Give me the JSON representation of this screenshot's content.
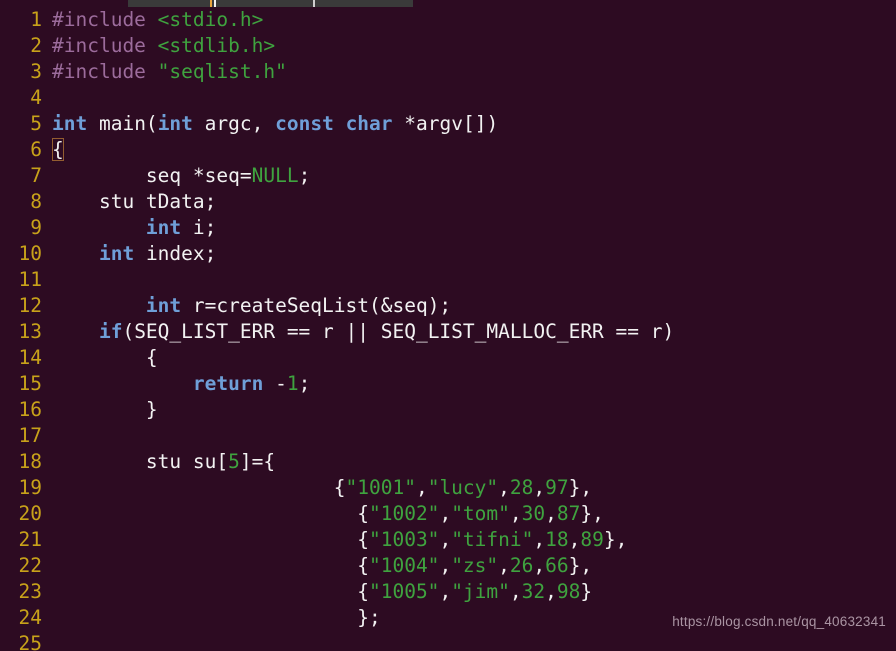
{
  "window": {
    "titlebar_visible_strip": true
  },
  "editor": {
    "background_color": "#2d0b22",
    "line_number_color": "#c8a21a",
    "default_text_color": "#f2f2f2",
    "keyword_color": "#6f9fd8",
    "string_color": "#3fa33f",
    "preprocessor_color": "#9c6c9c",
    "first_line_number": 1,
    "last_line_number": 25,
    "lines": [
      {
        "n": "1",
        "tokens": [
          {
            "t": "#include ",
            "c": "pp"
          },
          {
            "t": "<stdio.h>",
            "c": "str"
          }
        ]
      },
      {
        "n": "2",
        "tokens": [
          {
            "t": "#include ",
            "c": "pp"
          },
          {
            "t": "<stdlib.h>",
            "c": "str"
          }
        ]
      },
      {
        "n": "3",
        "tokens": [
          {
            "t": "#include ",
            "c": "pp"
          },
          {
            "t": "\"seqlist.h\"",
            "c": "str"
          }
        ]
      },
      {
        "n": "4",
        "tokens": []
      },
      {
        "n": "5",
        "tokens": [
          {
            "t": "int",
            "c": "k"
          },
          {
            "t": " main(",
            "c": "pl"
          },
          {
            "t": "int",
            "c": "k"
          },
          {
            "t": " argc, ",
            "c": "pl"
          },
          {
            "t": "const",
            "c": "k"
          },
          {
            "t": " ",
            "c": "pl"
          },
          {
            "t": "char",
            "c": "k"
          },
          {
            "t": " *argv[])",
            "c": "pl"
          }
        ]
      },
      {
        "n": "6",
        "tokens": [
          {
            "t": "{",
            "c": "cursor"
          }
        ]
      },
      {
        "n": "7",
        "tokens": [
          {
            "t": "        seq *seq=",
            "c": "pl"
          },
          {
            "t": "NULL",
            "c": "cst"
          },
          {
            "t": ";",
            "c": "pl"
          }
        ]
      },
      {
        "n": "8",
        "tokens": [
          {
            "t": "    stu tData;",
            "c": "pl"
          }
        ]
      },
      {
        "n": "9",
        "tokens": [
          {
            "t": "        ",
            "c": "pl"
          },
          {
            "t": "int",
            "c": "k"
          },
          {
            "t": " i;",
            "c": "pl"
          }
        ]
      },
      {
        "n": "10",
        "tokens": [
          {
            "t": "    ",
            "c": "pl"
          },
          {
            "t": "int",
            "c": "k"
          },
          {
            "t": " index;",
            "c": "pl"
          }
        ]
      },
      {
        "n": "11",
        "tokens": []
      },
      {
        "n": "12",
        "tokens": [
          {
            "t": "        ",
            "c": "pl"
          },
          {
            "t": "int",
            "c": "k"
          },
          {
            "t": " r=createSeqList(&seq);",
            "c": "pl"
          }
        ]
      },
      {
        "n": "13",
        "tokens": [
          {
            "t": "    ",
            "c": "pl"
          },
          {
            "t": "if",
            "c": "k"
          },
          {
            "t": "(SEQ_LIST_ERR == r || SEQ_LIST_MALLOC_ERR == r)",
            "c": "pl"
          }
        ]
      },
      {
        "n": "14",
        "tokens": [
          {
            "t": "        {",
            "c": "pl"
          }
        ]
      },
      {
        "n": "15",
        "tokens": [
          {
            "t": "            ",
            "c": "pl"
          },
          {
            "t": "return",
            "c": "k"
          },
          {
            "t": " -",
            "c": "pl"
          },
          {
            "t": "1",
            "c": "num"
          },
          {
            "t": ";",
            "c": "pl"
          }
        ]
      },
      {
        "n": "16",
        "tokens": [
          {
            "t": "        }",
            "c": "pl"
          }
        ]
      },
      {
        "n": "17",
        "tokens": []
      },
      {
        "n": "18",
        "tokens": [
          {
            "t": "        stu su[",
            "c": "pl"
          },
          {
            "t": "5",
            "c": "num"
          },
          {
            "t": "]={",
            "c": "pl"
          }
        ]
      },
      {
        "n": "19",
        "tokens": [
          {
            "t": "                        {",
            "c": "pl"
          },
          {
            "t": "\"1001\"",
            "c": "str"
          },
          {
            "t": ",",
            "c": "pl"
          },
          {
            "t": "\"lucy\"",
            "c": "str"
          },
          {
            "t": ",",
            "c": "pl"
          },
          {
            "t": "28",
            "c": "num"
          },
          {
            "t": ",",
            "c": "pl"
          },
          {
            "t": "97",
            "c": "num"
          },
          {
            "t": "},",
            "c": "pl"
          }
        ]
      },
      {
        "n": "20",
        "tokens": [
          {
            "t": "                          {",
            "c": "pl"
          },
          {
            "t": "\"1002\"",
            "c": "str"
          },
          {
            "t": ",",
            "c": "pl"
          },
          {
            "t": "\"tom\"",
            "c": "str"
          },
          {
            "t": ",",
            "c": "pl"
          },
          {
            "t": "30",
            "c": "num"
          },
          {
            "t": ",",
            "c": "pl"
          },
          {
            "t": "87",
            "c": "num"
          },
          {
            "t": "},",
            "c": "pl"
          }
        ]
      },
      {
        "n": "21",
        "tokens": [
          {
            "t": "                          {",
            "c": "pl"
          },
          {
            "t": "\"1003\"",
            "c": "str"
          },
          {
            "t": ",",
            "c": "pl"
          },
          {
            "t": "\"tifni\"",
            "c": "str"
          },
          {
            "t": ",",
            "c": "pl"
          },
          {
            "t": "18",
            "c": "num"
          },
          {
            "t": ",",
            "c": "pl"
          },
          {
            "t": "89",
            "c": "num"
          },
          {
            "t": "},",
            "c": "pl"
          }
        ]
      },
      {
        "n": "22",
        "tokens": [
          {
            "t": "                          {",
            "c": "pl"
          },
          {
            "t": "\"1004\"",
            "c": "str"
          },
          {
            "t": ",",
            "c": "pl"
          },
          {
            "t": "\"zs\"",
            "c": "str"
          },
          {
            "t": ",",
            "c": "pl"
          },
          {
            "t": "26",
            "c": "num"
          },
          {
            "t": ",",
            "c": "pl"
          },
          {
            "t": "66",
            "c": "num"
          },
          {
            "t": "},",
            "c": "pl"
          }
        ]
      },
      {
        "n": "23",
        "tokens": [
          {
            "t": "                          {",
            "c": "pl"
          },
          {
            "t": "\"1005\"",
            "c": "str"
          },
          {
            "t": ",",
            "c": "pl"
          },
          {
            "t": "\"jim\"",
            "c": "str"
          },
          {
            "t": ",",
            "c": "pl"
          },
          {
            "t": "32",
            "c": "num"
          },
          {
            "t": ",",
            "c": "pl"
          },
          {
            "t": "98",
            "c": "num"
          },
          {
            "t": "}",
            "c": "pl"
          }
        ]
      },
      {
        "n": "24",
        "tokens": [
          {
            "t": "                          };",
            "c": "pl"
          }
        ]
      },
      {
        "n": "25",
        "tokens": []
      }
    ]
  },
  "watermark": {
    "text": "https://blog.csdn.net/qq_40632341"
  }
}
